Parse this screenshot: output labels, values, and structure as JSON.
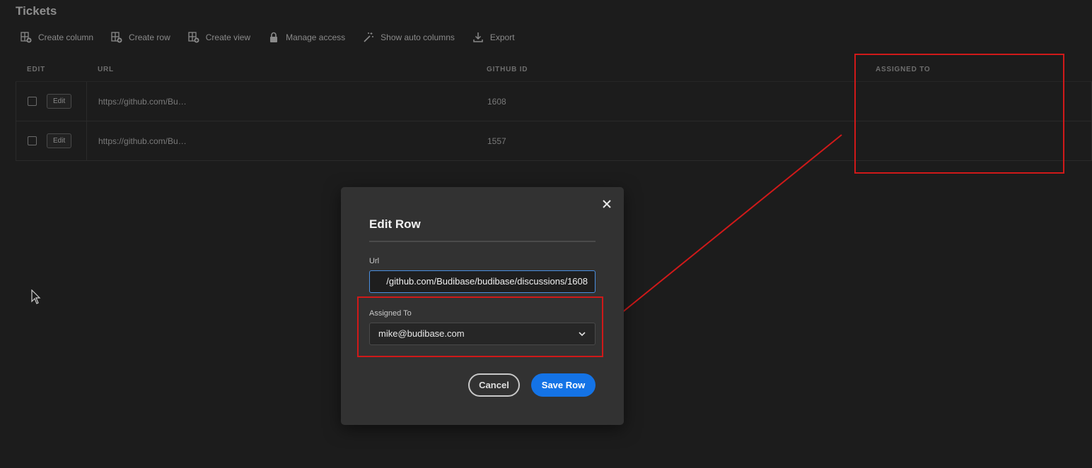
{
  "page": {
    "title": "Tickets"
  },
  "toolbar": {
    "items": [
      {
        "label": "Create column",
        "icon": "create-column-icon"
      },
      {
        "label": "Create row",
        "icon": "create-row-icon"
      },
      {
        "label": "Create view",
        "icon": "create-view-icon"
      },
      {
        "label": "Manage access",
        "icon": "lock-icon"
      },
      {
        "label": "Show auto columns",
        "icon": "magic-wand-icon"
      },
      {
        "label": "Export",
        "icon": "download-icon"
      }
    ]
  },
  "grid": {
    "headers": {
      "edit": "EDIT",
      "url": "URL",
      "github_id": "GITHUB ID",
      "assigned_to": "ASSIGNED TO"
    },
    "rows": [
      {
        "edit_label": "Edit",
        "url": "https://github.com/Bu…",
        "github_id": "1608",
        "assigned_to": ""
      },
      {
        "edit_label": "Edit",
        "url": "https://github.com/Bu…",
        "github_id": "1557",
        "assigned_to": ""
      }
    ]
  },
  "modal": {
    "title": "Edit Row",
    "url_label": "Url",
    "url_value": "/github.com/Budibase/budibase/discussions/1608",
    "assigned_label": "Assigned To",
    "assigned_value": "mike@budibase.com",
    "cancel_label": "Cancel",
    "save_label": "Save Row"
  },
  "colors": {
    "annotation": "#d01919",
    "primary_button": "#1473e6",
    "input_focus": "#4a90e2"
  }
}
